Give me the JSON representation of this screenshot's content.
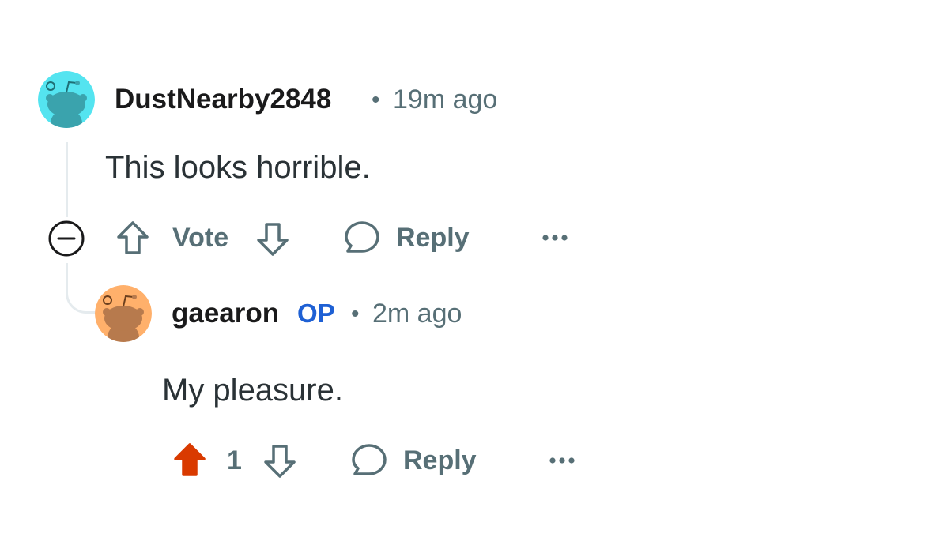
{
  "comments": [
    {
      "username": "DustNearby2848",
      "separator": "•",
      "time": "19m ago",
      "body": "This looks horrible.",
      "avatar_color": "#54e4f0",
      "actions": {
        "vote_label": "Vote",
        "reply_label": "Reply",
        "more_icon": "ellipsis-icon",
        "collapse_icon": "minus-circle-icon"
      }
    },
    {
      "username": "gaearon",
      "badge": "OP",
      "separator": "•",
      "time": "2m ago",
      "body": "My pleasure.",
      "avatar_color": "#ffb06b",
      "upvoted": true,
      "actions": {
        "score": "1",
        "reply_label": "Reply",
        "more_icon": "ellipsis-icon",
        "upvote_color": "#d93a00"
      }
    }
  ],
  "colors": {
    "meta_text": "#576f76",
    "op_badge": "#1e60d4",
    "thread_line": "#e5ebee"
  }
}
